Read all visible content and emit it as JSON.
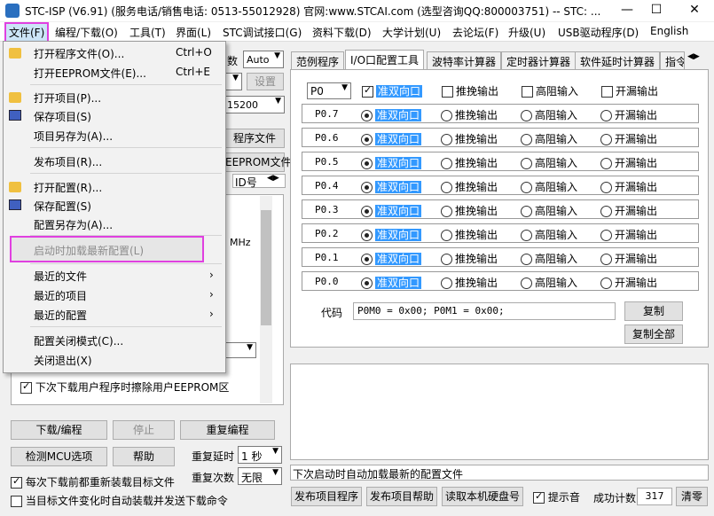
{
  "window": {
    "title": "STC-ISP (V6.91) (服务电话/销售电话: 0513-55012928) 官网:www.STCAI.com  (选型咨询QQ:800003751) -- STC: ...",
    "minimize": "—",
    "maximize": "☐",
    "close": "✕"
  },
  "menu": [
    "文件(F)",
    "编程/下载(O)",
    "工具(T)",
    "界面(L)",
    "STC调试接口(G)",
    "资料下载(D)",
    "大学计划(U)",
    "去论坛(F)",
    "升级(U)",
    "USB驱动程序(D)",
    "English"
  ],
  "file_menu": {
    "open_program": "打开程序文件(O)...",
    "open_program_sc": "Ctrl+O",
    "open_eeprom": "打开EEPROM文件(E)...",
    "open_eeprom_sc": "Ctrl+E",
    "open_project": "打开项目(P)...",
    "save_project": "保存项目(S)",
    "save_project_as": "项目另存为(A)...",
    "publish_project": "发布项目(R)...",
    "open_config": "打开配置(R)...",
    "save_config": "保存配置(S)",
    "save_config_as": "配置另存为(A)...",
    "load_latest_config": "启动时加载最新配置(L)",
    "recent_files": "最近的文件",
    "recent_projects": "最近的项目",
    "recent_configs": "最近的配置",
    "config_close_mode": "配置关闭模式(C)...",
    "exit": "关闭退出(X)"
  },
  "left": {
    "freq_label": "数",
    "freq_value": "Auto",
    "set_btn": "设置",
    "baud_value": "15200",
    "prog_file_btn": "程序文件",
    "eeprom_file_btn": "EEPROM文件",
    "id_label": "ID号",
    "mhz": "MHz",
    "erase_eeprom": "下次下载用户程序时擦除用户EEPROM区",
    "download_btn": "下载/编程",
    "stop_btn": "停止",
    "reprogram_btn": "重复编程",
    "check_mcu_btn": "检测MCU选项",
    "help_btn": "帮助",
    "repeat_delay_label": "重复延时",
    "repeat_delay_value": "1 秒",
    "repeat_count_label": "重复次数",
    "repeat_count_value": "无限",
    "reload_each": "每次下载前都重新装载目标文件",
    "auto_on_change": "当目标文件变化时自动装载并发送下载命令"
  },
  "tabs": [
    "范例程序",
    "I/O口配置工具",
    "波特率计算器",
    "定时器计算器",
    "软件延时计算器",
    "指令"
  ],
  "io": {
    "port": "P0",
    "options": [
      "准双向口",
      "推挽输出",
      "高阻输入",
      "开漏输出"
    ],
    "pins": [
      "P0.7",
      "P0.6",
      "P0.5",
      "P0.4",
      "P0.3",
      "P0.2",
      "P0.1",
      "P0.0"
    ],
    "code_label": "代码",
    "code_value": "P0M0 = 0x00;  P0M1 = 0x00;",
    "copy_btn": "复制",
    "copy_all_btn": "复制全部"
  },
  "status": {
    "message": "下次启动时自动加载最新的配置文件",
    "publish_btn": "发布项目程序",
    "publish_help_btn": "发布项目帮助",
    "read_disk_btn": "读取本机硬盘号",
    "sound_label": "提示音",
    "success_label": "成功计数",
    "success_value": "317",
    "clear_btn": "清零"
  }
}
